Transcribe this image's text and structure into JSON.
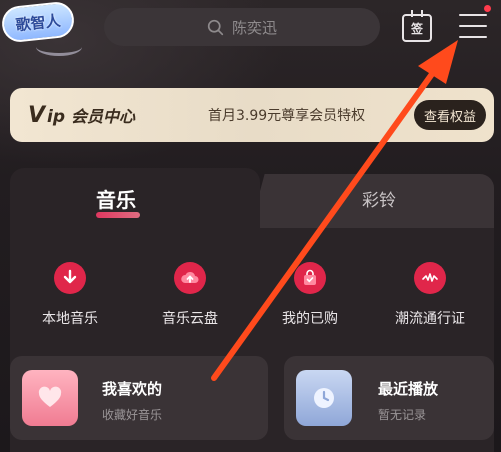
{
  "header": {
    "logo_text": "歌智人",
    "search_placeholder": "陈奕迅",
    "sign_icon_text": "签"
  },
  "vip": {
    "badge_v": "V",
    "badge_ip": "ip",
    "title": "会员中心",
    "description": "首月3.99元尊享会员特权",
    "button": "查看权益"
  },
  "tabs": [
    {
      "label": "音乐",
      "active": true
    },
    {
      "label": "彩铃",
      "active": false
    }
  ],
  "quick_actions": [
    {
      "label": "本地音乐",
      "icon": "download-arrow-icon"
    },
    {
      "label": "音乐云盘",
      "icon": "cloud-upload-icon"
    },
    {
      "label": "我的已购",
      "icon": "shopping-bag-icon"
    },
    {
      "label": "潮流通行证",
      "icon": "wave-badge-icon"
    }
  ],
  "cards": {
    "favorites": {
      "title": "我喜欢的",
      "subtitle": "收藏好音乐",
      "icon": "heart-icon"
    },
    "recent": {
      "title": "最近播放",
      "subtitle": "暂无记录",
      "icon": "clock-icon"
    }
  },
  "colors": {
    "accent": "#e0264a",
    "arrow": "#ff4a1c",
    "vip_bg": "#f2e6d2",
    "background": "#1f1b1f"
  }
}
